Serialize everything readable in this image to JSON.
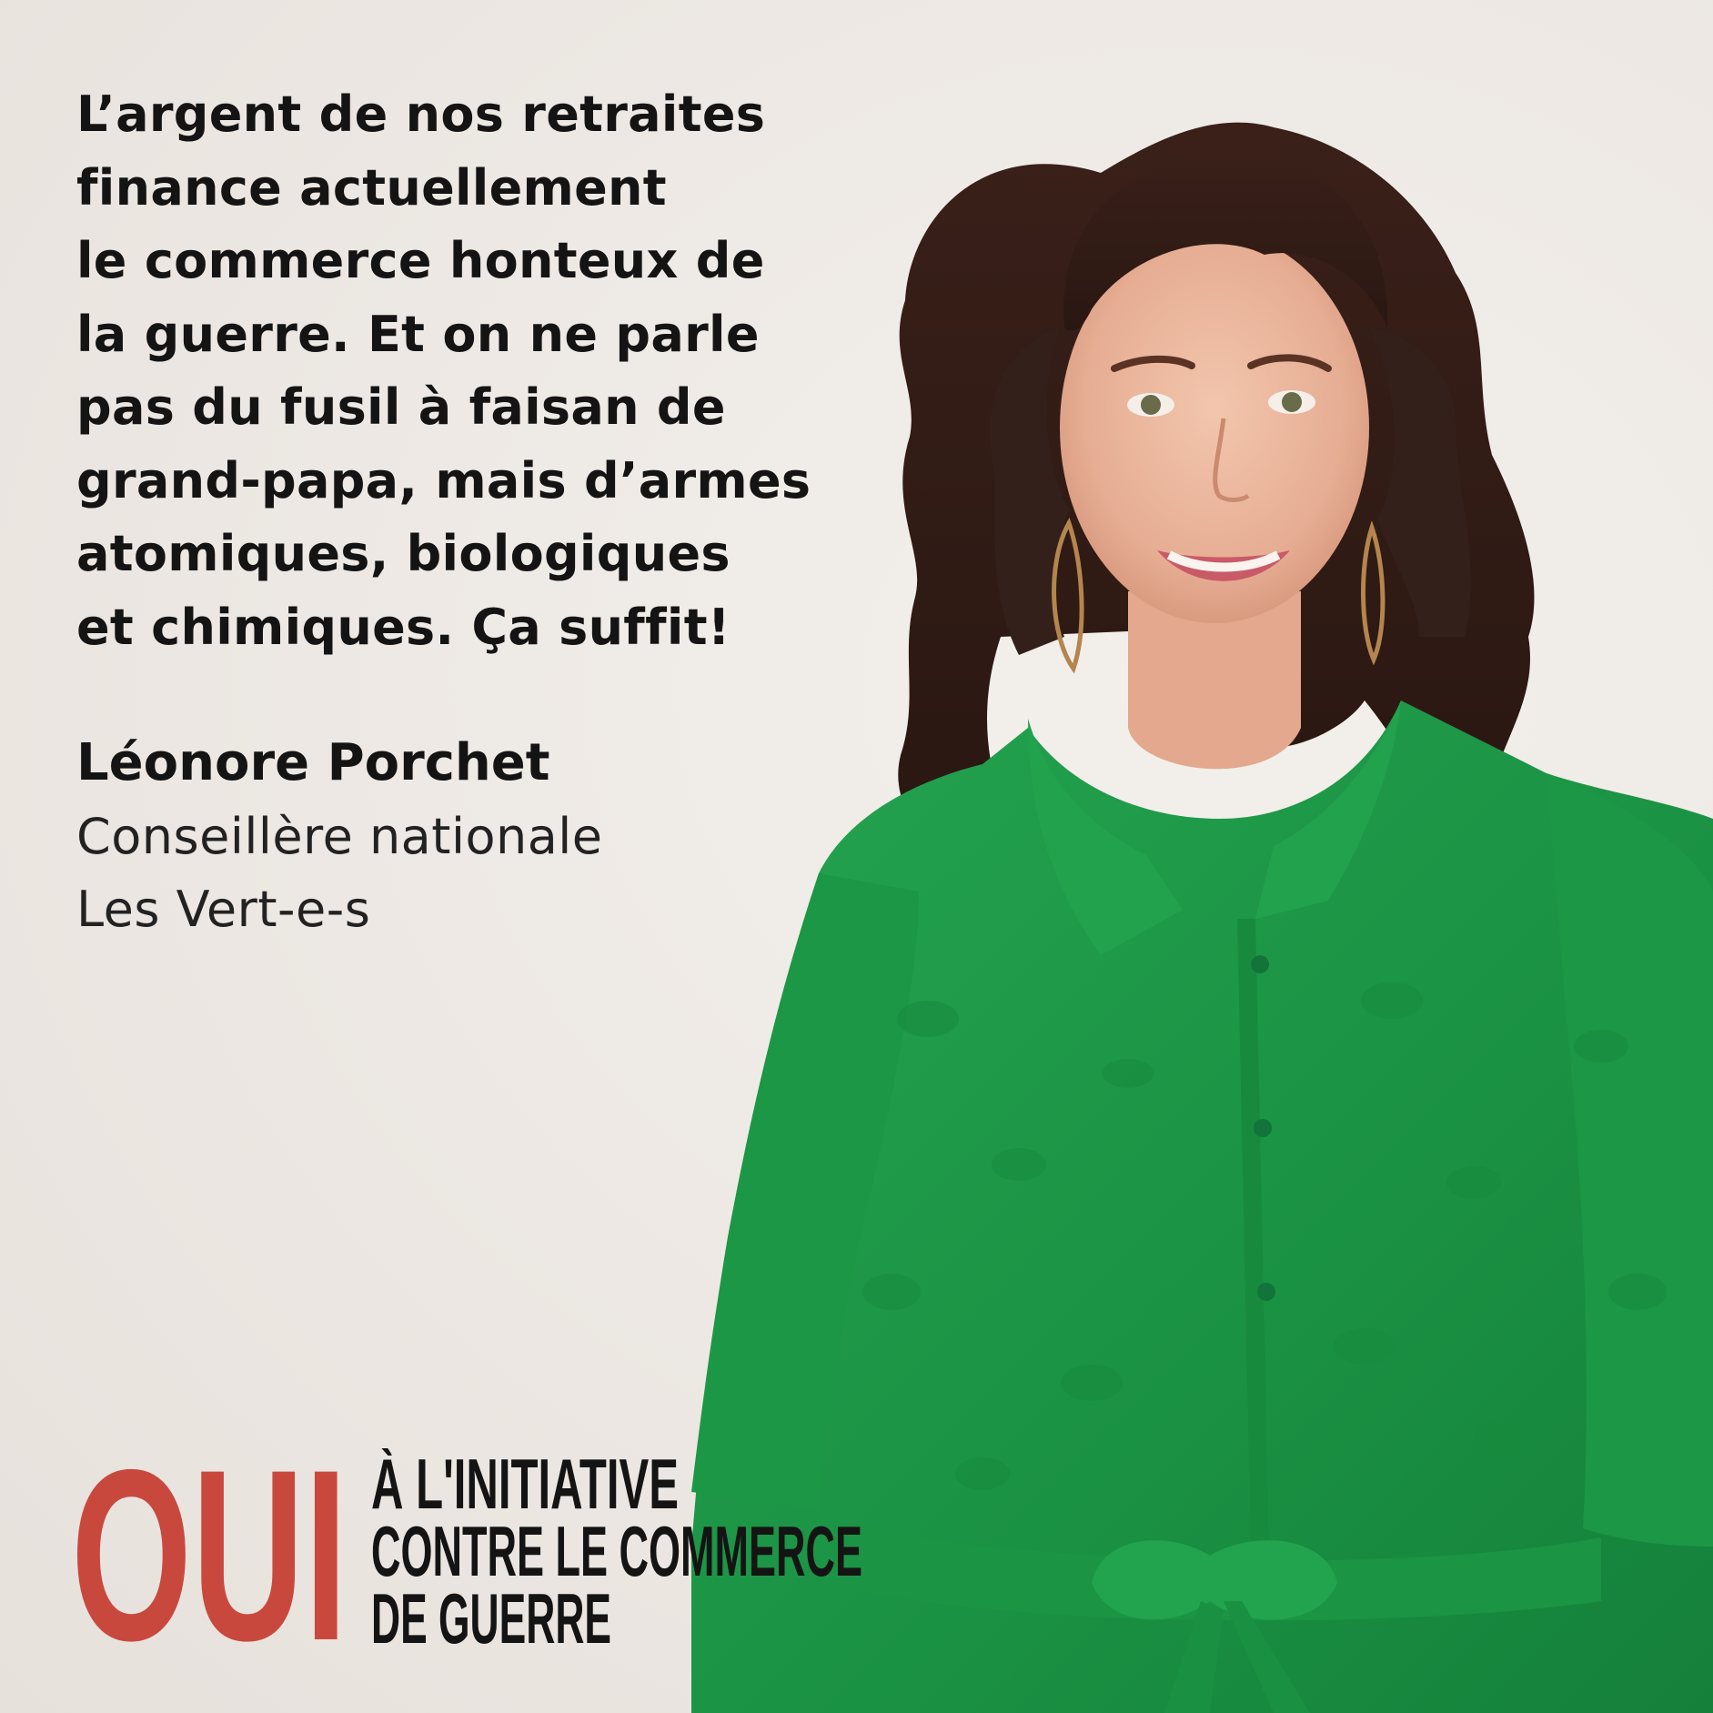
{
  "quote": {
    "lines": [
      "L’argent de nos retraites",
      "finance actuellement",
      "le commerce honteux de",
      "la guerre. Et on ne parle",
      "pas du fusil à faisan de",
      "grand-papa, mais d’armes",
      "atomiques, biologiques",
      "et chimiques. Ça suffit!"
    ]
  },
  "person": {
    "name": "Léonore Porchet",
    "role": "Conseillère nationale",
    "party": "Les Vert-e-s"
  },
  "campaign": {
    "oui": "OUI",
    "line1": "À L'INITIATIVE",
    "line2": "CONTRE LE COMMERCE",
    "line3": "DE GUERRE"
  },
  "colors": {
    "background": "#efebe7",
    "text": "#141414",
    "accent_red": "#c9483e",
    "dress_green": "#1e9a48"
  }
}
